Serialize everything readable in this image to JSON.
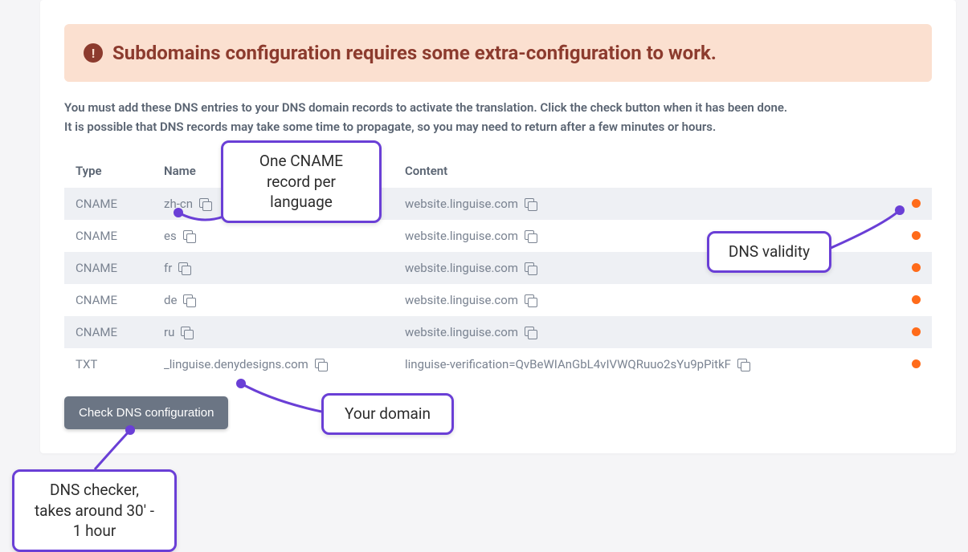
{
  "alert": {
    "icon_glyph": "!",
    "text": "Subdomains configuration requires some extra-configuration to work."
  },
  "description": {
    "line1": "You must add these DNS entries to your DNS domain records to activate the translation. Click the check button when it has been done.",
    "line2": "It is possible that DNS records may take some time to propagate, so you may need to return after a few minutes or hours."
  },
  "table": {
    "headers": {
      "type": "Type",
      "name": "Name",
      "content": "Content"
    },
    "rows": [
      {
        "type": "CNAME",
        "name": "zh-cn",
        "content": "website.linguise.com"
      },
      {
        "type": "CNAME",
        "name": "es",
        "content": "website.linguise.com"
      },
      {
        "type": "CNAME",
        "name": "fr",
        "content": "website.linguise.com"
      },
      {
        "type": "CNAME",
        "name": "de",
        "content": "website.linguise.com"
      },
      {
        "type": "CNAME",
        "name": "ru",
        "content": "website.linguise.com"
      },
      {
        "type": "TXT",
        "name": "_linguise.denydesigns.com",
        "content": "linguise-verification=QvBeWIAnGbL4vIVWQRuuo2sYu9pPitkF"
      }
    ]
  },
  "button": {
    "check_label": "Check DNS configuration"
  },
  "callouts": {
    "cname": "One CNAME record per language",
    "validity": "DNS validity",
    "domain": "Your domain",
    "dnschecker": "DNS checker, takes around 30' - 1 hour"
  },
  "colors": {
    "accent": "#6a3fd6",
    "status_invalid": "#ff6b1a",
    "alert_bg": "#fbe0d0",
    "alert_fg": "#8c3b2e"
  }
}
